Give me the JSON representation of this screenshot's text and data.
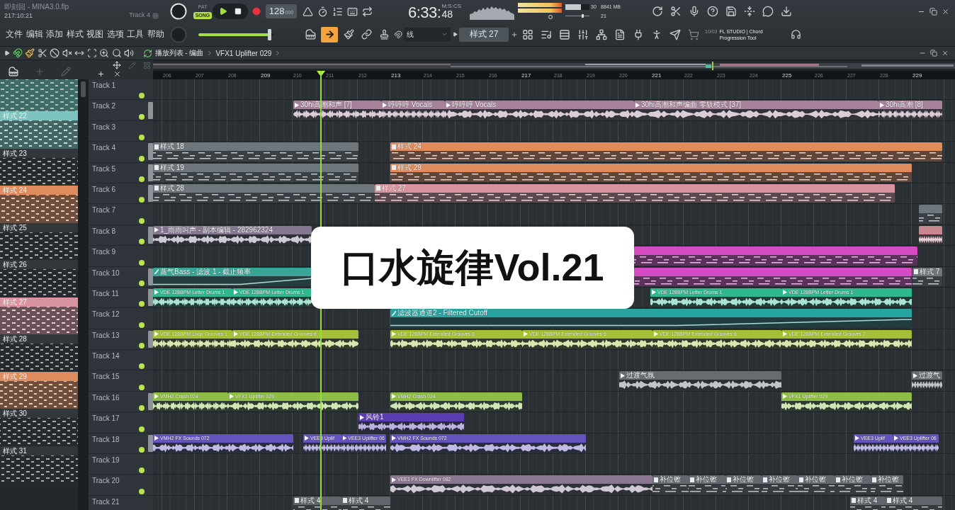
{
  "title_bar": {
    "file_name": "即刻回 - MINA3.0.flp",
    "song_position": "217:10:21",
    "hint": "Track 4"
  },
  "transport": {
    "modes": [
      {
        "label": "PAT",
        "selected": false
      },
      {
        "label": "SONG",
        "selected": true
      }
    ],
    "tempo": "128",
    "tempo_decimals": "000",
    "time": "6:33:",
    "time_centiseconds": "48",
    "time_format": "M:S:CS"
  },
  "monitor": {
    "cpu_meter": {
      "level": 0.65
    },
    "cpu": "30",
    "memory": "8841 MB",
    "slider": {
      "level": 0.72
    },
    "voices": "21"
  },
  "menu": [
    "文件",
    "编辑",
    "添加",
    "样式",
    "视图",
    "选项",
    "工具",
    "帮助"
  ],
  "master_volume": {
    "level": 0.95
  },
  "tools": [
    {
      "selected": false
    },
    {
      "selected": true
    },
    {
      "selected": false
    },
    {
      "selected": false
    },
    {
      "selected": false
    }
  ],
  "snap": {
    "value": "线"
  },
  "pattern_selector": {
    "value": "样式 27"
  },
  "news": {
    "date": "10/03",
    "headline": "FL STUDIO | Chord Progression Tool"
  },
  "playlist": {
    "breadcrumb": [
      "播放列表 - 编曲",
      "VFX1 Uplifter 029"
    ],
    "ruler": [
      "206",
      "207",
      "208",
      "209",
      "210",
      "211",
      "212",
      "213",
      "214",
      "215",
      "216",
      "217",
      "218",
      "219",
      "220",
      "221",
      "222",
      "223",
      "224",
      "225",
      "226",
      "227",
      "228",
      "229"
    ],
    "patterns": [
      {
        "color": "#3e6d68"
      },
      {
        "label": "样式 22",
        "color": "#7cc4bd"
      },
      {
        "label": "样式 23",
        "color": "#31373b"
      },
      {
        "label": "样式 24",
        "color": "#de8c5e"
      },
      {
        "label": "样式 25",
        "color": "#31373b"
      },
      {
        "label": "样式 26",
        "color": "#31373b"
      },
      {
        "label": "样式 27",
        "color": "#d8939e"
      },
      {
        "label": "样式 28",
        "color": "#31373b"
      },
      {
        "label": "样式 29",
        "color": "#de8c5e"
      },
      {
        "label": "样式 30",
        "color": "#31373b"
      },
      {
        "label": "样式 31",
        "color": "#31373b"
      }
    ],
    "tracks": [
      {
        "name": "Track 1",
        "enabled": true,
        "continues_left": false
      },
      {
        "name": "Track 2",
        "enabled": true,
        "continues_left": true,
        "clips": [
          {
            "kind": "audio",
            "label": "30hi高潮和声 [7]",
            "color": "#a6829a"
          },
          {
            "kind": "audio",
            "label": "哼哼哼 Vocals",
            "color": "#a6829a"
          },
          {
            "kind": "audio",
            "label": "哼哼哼 Vocals",
            "color": "#a6829a"
          },
          {
            "kind": "audio",
            "label": "30hi高潮和声编曲 零轨模式 [37]",
            "color": "#a6829a"
          },
          {
            "kind": "audio",
            "label": "30hi高潮 [8]",
            "color": "#a6829a"
          }
        ]
      },
      {
        "name": "Track 3",
        "enabled": true,
        "continues_left": false
      },
      {
        "name": "Track 4",
        "enabled": true,
        "continues_left": true,
        "clips": [
          {
            "kind": "pattern",
            "label": "样式 18",
            "color": "#6e757b"
          },
          {
            "kind": "pattern",
            "label": "样式 24",
            "color": "#de8c5e"
          }
        ]
      },
      {
        "name": "Track 5",
        "enabled": true,
        "continues_left": true,
        "clips": [
          {
            "kind": "pattern",
            "label": "样式 19",
            "color": "#6e757b"
          },
          {
            "kind": "pattern",
            "label": "样式 29",
            "color": "#de8c5e"
          }
        ]
      },
      {
        "name": "Track 6",
        "enabled": true,
        "continues_left": true,
        "clips": [
          {
            "kind": "pattern",
            "label": "样式 28",
            "color": "#6e757b"
          },
          {
            "kind": "pattern",
            "label": "样式 27",
            "color": "#d8939e"
          }
        ]
      },
      {
        "name": "Track 7",
        "enabled": true,
        "continues_left": false,
        "clips": [
          {
            "kind": "pattern",
            "color": "#6e757b"
          }
        ]
      },
      {
        "name": "Track 8",
        "enabled": true,
        "continues_left": true,
        "clips": [
          {
            "kind": "audio",
            "label": "1_雨雨叫声 - 副本编辑 - 282962324",
            "color": "#857790"
          },
          {
            "kind": "audio",
            "color": "#c98890"
          }
        ]
      },
      {
        "name": "Track 9",
        "enabled": true,
        "continues_left": false,
        "clips": [
          {
            "kind": "pattern",
            "color": "#d54cc2"
          }
        ]
      },
      {
        "name": "Track 10",
        "enabled": true,
        "continues_left": true,
        "clips": [
          {
            "kind": "automation",
            "label": "蒸气Bass - 滤波 1 - 截止频率",
            "color": "#39a596"
          },
          {
            "kind": "pattern",
            "color": "#d54cc2"
          },
          {
            "kind": "pattern",
            "label": "样式 7",
            "color": "#6e757b"
          }
        ]
      },
      {
        "name": "Track 11",
        "enabled": true,
        "continues_left": true,
        "clips": [
          {
            "kind": "audio",
            "label": "VDE 128BPM Letter Drums 1",
            "color": "#2db88e"
          },
          {
            "kind": "audio",
            "label": "VDE 128BPM Letter Drums 1",
            "color": "#2db88e"
          },
          {
            "kind": "audio",
            "label": "VDE 128BPM Letter Drums 1",
            "color": "#2db88e"
          },
          {
            "kind": "audio",
            "label": "VDE 128BPM Letter Drums 1",
            "color": "#2db88e"
          }
        ]
      },
      {
        "name": "Track 12",
        "enabled": true,
        "continues_left": false,
        "clips": [
          {
            "kind": "automation",
            "label": "滤波器通道2 - Filtered Cutoff",
            "color": "#27a3a0"
          }
        ]
      },
      {
        "name": "Track 13",
        "enabled": true,
        "continues_left": true,
        "clips": [
          {
            "kind": "audio",
            "label": "VDE 128BPM Loop Grooves 1",
            "color": "#a5bf36"
          },
          {
            "kind": "audio",
            "label": "VDE 128BPM Extended Grooves 6",
            "color": "#a5bf36"
          },
          {
            "kind": "audio",
            "label": "VDE 128BPM Extended Grooves 6",
            "color": "#a5bf36"
          },
          {
            "kind": "audio",
            "label": "VDE 128BPM Extended Grooves 6",
            "color": "#a5bf36"
          },
          {
            "kind": "audio",
            "label": "VDE 128BPM Extended Grooves 6",
            "color": "#a5bf36"
          },
          {
            "kind": "audio",
            "label": "VDE 128BPM Extended Grooves 2",
            "color": "#a5bf36"
          }
        ]
      },
      {
        "name": "Track 14",
        "enabled": true,
        "continues_left": false
      },
      {
        "name": "Track 15",
        "enabled": true,
        "continues_left": false,
        "clips": [
          {
            "kind": "audio",
            "label": "过渡气氛",
            "color": "#676c71"
          },
          {
            "kind": "audio",
            "label": "过渡气",
            "color": "#676c71"
          }
        ]
      },
      {
        "name": "Track 16",
        "enabled": true,
        "continues_left": true,
        "clips": [
          {
            "kind": "audio",
            "label": "VMH2 Crash 024",
            "color": "#8dbd46"
          },
          {
            "kind": "audio",
            "label": "VFX1 Uplifter 029",
            "color": "#8dbd46"
          },
          {
            "kind": "audio",
            "label": "VMH2 Crash 024",
            "color": "#8dbd46"
          },
          {
            "kind": "audio",
            "label": "VFX1 Uplifter 029",
            "color": "#8dbd46"
          }
        ]
      },
      {
        "name": "Track 17",
        "enabled": true,
        "continues_left": false,
        "clips": [
          {
            "kind": "audio",
            "label": "风铃1",
            "color": "#5a3db0"
          }
        ]
      },
      {
        "name": "Track 18",
        "enabled": true,
        "continues_left": true,
        "clips": [
          {
            "kind": "audio",
            "label": "VMH2 FX Sounds 072",
            "color": "#6552bd"
          },
          {
            "kind": "audio",
            "label": "VEE3 Uplif",
            "color": "#6552bd"
          },
          {
            "kind": "audio",
            "label": "VEE3 Uplifter 06",
            "color": "#6552bd"
          },
          {
            "kind": "audio",
            "label": "VMH2 FX Sounds 072",
            "color": "#6552bd"
          },
          {
            "kind": "audio",
            "label": "VEE3 Uplif",
            "color": "#6552bd"
          },
          {
            "kind": "audio",
            "label": "VEE3 Uplifter 06",
            "color": "#6552bd"
          }
        ]
      },
      {
        "name": "Track 19",
        "enabled": true,
        "continues_left": false
      },
      {
        "name": "Track 20",
        "enabled": true,
        "continues_left": false,
        "clips": [
          {
            "kind": "audio",
            "label": "VEE1 FX Downlifter 082",
            "color": "#8a7690"
          },
          {
            "kind": "pattern",
            "label": "补位镲",
            "color": "#62686d"
          },
          {
            "kind": "pattern",
            "label": "补位镲",
            "color": "#62686d"
          },
          {
            "kind": "pattern",
            "label": "补位镲",
            "color": "#62686d"
          },
          {
            "kind": "pattern",
            "label": "补位镲",
            "color": "#62686d"
          },
          {
            "kind": "pattern",
            "label": "补位镲",
            "color": "#62686d"
          },
          {
            "kind": "pattern",
            "label": "补位镲",
            "color": "#62686d"
          },
          {
            "kind": "pattern",
            "label": "补位镲",
            "color": "#62686d"
          }
        ]
      },
      {
        "name": "Track 21",
        "continues_left": false,
        "clips": [
          {
            "kind": "pattern",
            "label": "样式 4",
            "color": "#5f656a"
          },
          {
            "kind": "pattern",
            "label": "样式 4",
            "color": "#5f656a"
          },
          {
            "kind": "pattern",
            "label": "样式 4",
            "color": "#5f656a"
          },
          {
            "kind": "pattern",
            "label": "样式 4",
            "color": "#5f656a"
          }
        ]
      }
    ]
  },
  "caption": "口水旋律Vol.21"
}
